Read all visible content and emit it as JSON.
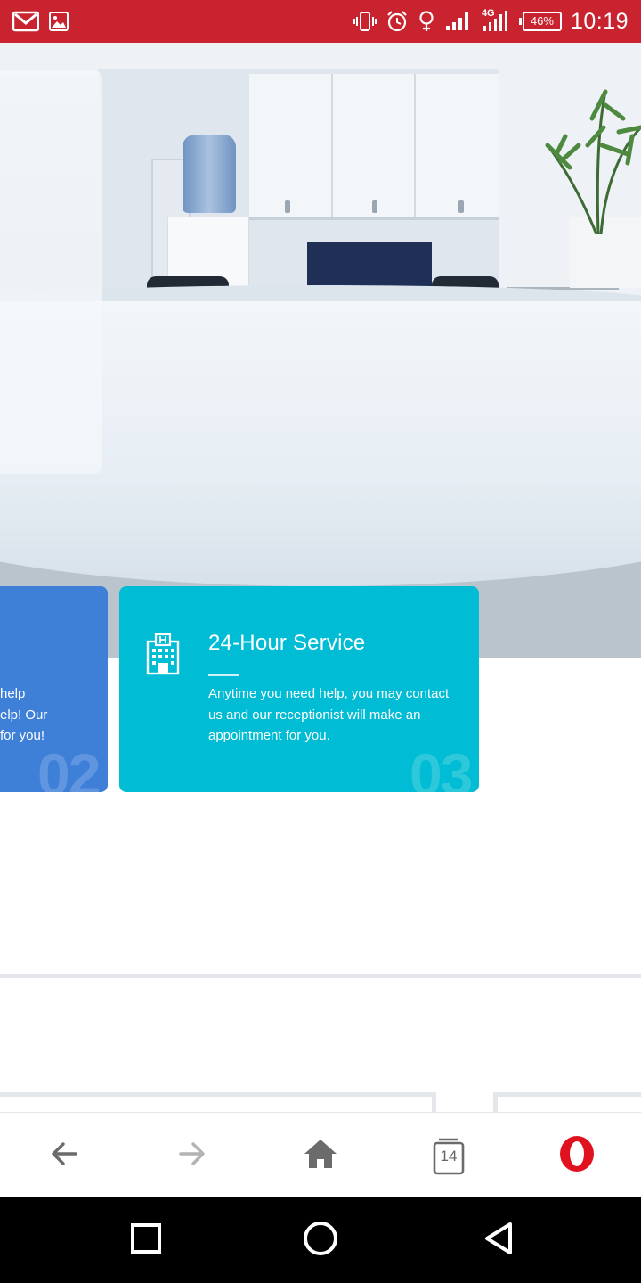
{
  "status_bar": {
    "time": "10:19",
    "battery": "46%",
    "network_label": "4G",
    "left_icons": [
      "gmail-icon",
      "gallery-icon"
    ],
    "right_icons": [
      "vibrate-icon",
      "alarm-icon",
      "location-icon",
      "signal-icon",
      "signal-4g-icon",
      "battery-icon"
    ],
    "background": "#c8232e"
  },
  "hero": {
    "image_alt": "reception-desk-photo"
  },
  "cards": {
    "previous": {
      "text_lines": [
        "help",
        "elp! Our",
        "for you!"
      ],
      "number": "02",
      "color": "#3e7fd8"
    },
    "main": {
      "icon": "hospital-building-icon",
      "title": "24-Hour Service",
      "description": "Anytime you need help, you may contact us and our receptionist will make an appointment for you.",
      "number": "03",
      "color": "#00bcd4"
    }
  },
  "browser_nav": {
    "buttons": [
      "back-arrow-icon",
      "forward-arrow-icon",
      "home-icon",
      "tabs-icon",
      "opera-menu-icon"
    ],
    "tab_count": "14"
  },
  "system_nav": {
    "buttons": [
      "recents-square-icon",
      "home-circle-icon",
      "back-triangle-icon"
    ]
  }
}
